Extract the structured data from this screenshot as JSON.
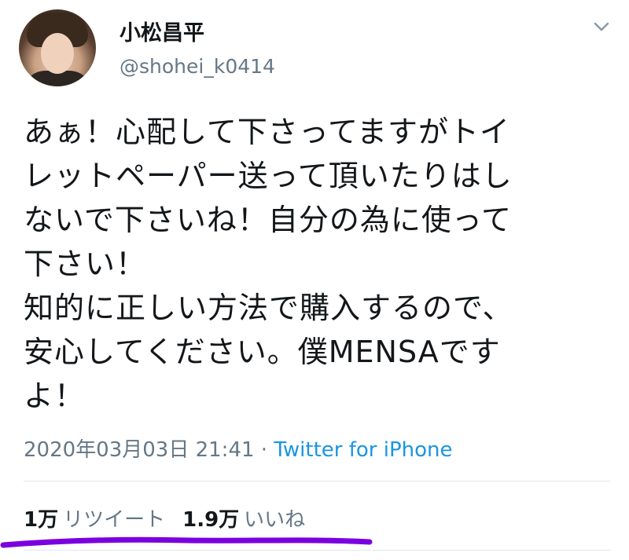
{
  "tweet": {
    "display_name": "小松昌平",
    "handle": "@shohei_k0414",
    "body_lines": [
      "あぁ！心配して下さってますがトイ",
      "レットペーパー送って頂いたりはし",
      "ないで下さいね！自分の為に使って",
      "下さい！",
      "知的に正しい方法で購入するので、",
      "安心してください。僕MENSAです",
      "よ！"
    ],
    "timestamp": "2020年03月03日 21:41",
    "separator": " · ",
    "source": "Twitter for iPhone",
    "retweets": {
      "count": "1万",
      "label": "リツイート"
    },
    "likes": {
      "count": "1.9万",
      "label": "いいね"
    }
  },
  "colors": {
    "text": "#14171a",
    "secondary": "#657786",
    "link": "#1b95e0",
    "divider": "#e1e8ed",
    "scribble": "#7b00e0"
  },
  "icons": {
    "menu": "chevron-down-icon"
  }
}
